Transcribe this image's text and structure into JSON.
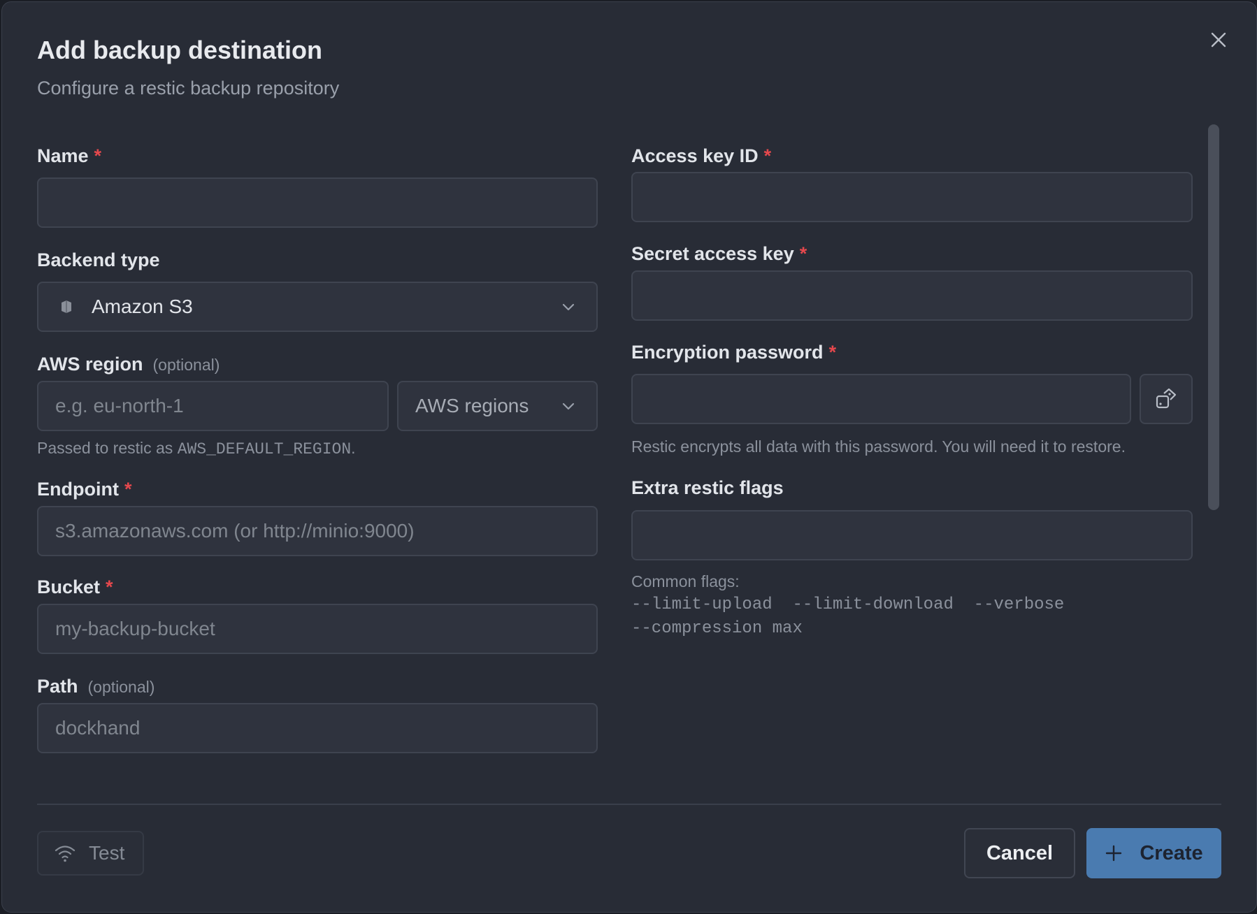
{
  "dialog": {
    "title": "Add backup destination",
    "subtitle": "Configure a restic backup repository"
  },
  "form": {
    "name": {
      "label": "Name",
      "required_marker": "*",
      "value": "",
      "placeholder": ""
    },
    "backend_type": {
      "label": "Backend type",
      "selected": "Amazon S3",
      "icon": "s3-bucket-icon"
    },
    "aws_region": {
      "label": "AWS region",
      "optional_text": "(optional)",
      "placeholder": "e.g. eu-north-1",
      "value": "",
      "dropdown_label": "AWS regions",
      "hint_prefix": "Passed to restic as",
      "hint_code": "AWS_DEFAULT_REGION",
      "hint_suffix": "."
    },
    "endpoint": {
      "label": "Endpoint",
      "required_marker": "*",
      "placeholder": "s3.amazonaws.com (or http://minio:9000)",
      "value": ""
    },
    "bucket": {
      "label": "Bucket",
      "required_marker": "*",
      "placeholder": "my-backup-bucket",
      "value": ""
    },
    "path": {
      "label": "Path",
      "optional_text": "(optional)",
      "placeholder": "dockhand",
      "value": ""
    },
    "access_key_id": {
      "label": "Access key ID",
      "required_marker": "*",
      "value": ""
    },
    "secret_access_key": {
      "label": "Secret access key",
      "required_marker": "*",
      "value": ""
    },
    "encryption_password": {
      "label": "Encryption password",
      "required_marker": "*",
      "value": "",
      "generate_icon": "dice-icon",
      "hint": "Restic encrypts all data with this password. You will need it to restore."
    },
    "extra_flags": {
      "label": "Extra restic flags",
      "value": "",
      "hint_title": "Common flags:",
      "flags_line1": "--limit-upload  --limit-download  --verbose",
      "flags_line2": "--compression max"
    }
  },
  "footer": {
    "test_label": "Test",
    "test_icon": "wifi-icon",
    "cancel_label": "Cancel",
    "create_label": "Create",
    "create_icon": "plus-icon"
  },
  "colors": {
    "background": "#282c36",
    "input_bg": "#2f333e",
    "required": "#e5484d",
    "primary": "#4a7bb0"
  }
}
